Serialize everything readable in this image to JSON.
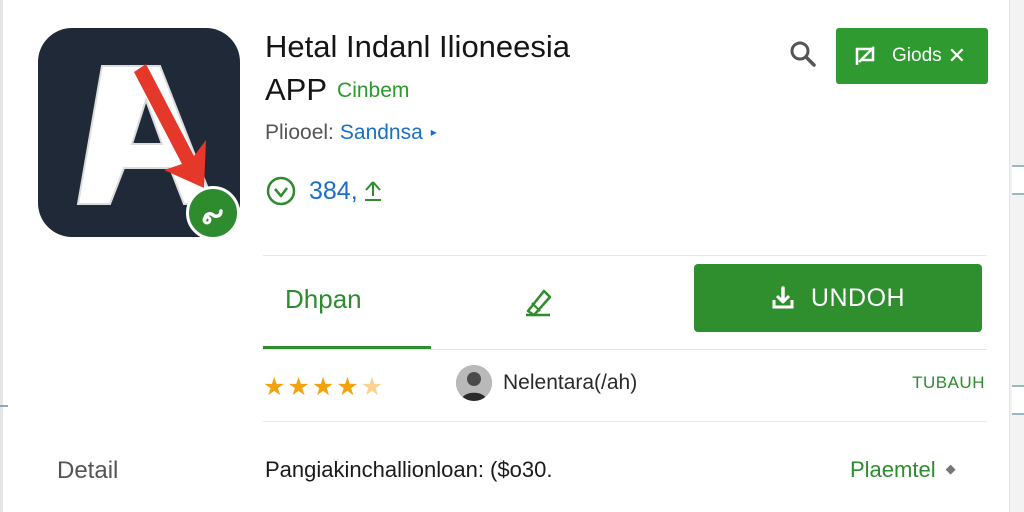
{
  "app": {
    "title": "Hetal Indanl Ilioneesia",
    "subtitle": "APP",
    "tag": "Cinbem",
    "publisher_label": "Pliooel:",
    "publisher_name": "Sandnsa",
    "downloads": "384,"
  },
  "header": {
    "close_label": "Giods",
    "close_x": "✕"
  },
  "actions": {
    "open_label": "Dhpan",
    "install_label": "UNDOH"
  },
  "rating": {
    "stars": 4.5,
    "reviewer": "Nelentara(/ah)",
    "report_label": "TUBAUH"
  },
  "detail": {
    "label": "Detail",
    "value": "Pangiakinchallionloan: ($o30.",
    "link": "Plaemtel"
  },
  "colors": {
    "brand_green": "#2f8f2f",
    "link_blue": "#1a6fc4",
    "star_orange": "#f2a20c",
    "icon_bg": "#1f2937",
    "icon_red": "#e5372a"
  },
  "icons": {
    "app": "letter-a-arrow-app-icon",
    "badge": "link-badge-icon",
    "search": "search-icon",
    "edit": "edit-pencil-icon",
    "close_chip": "edit-flag-icon",
    "install": "download-icon",
    "downloads": "shield-check-icon"
  }
}
